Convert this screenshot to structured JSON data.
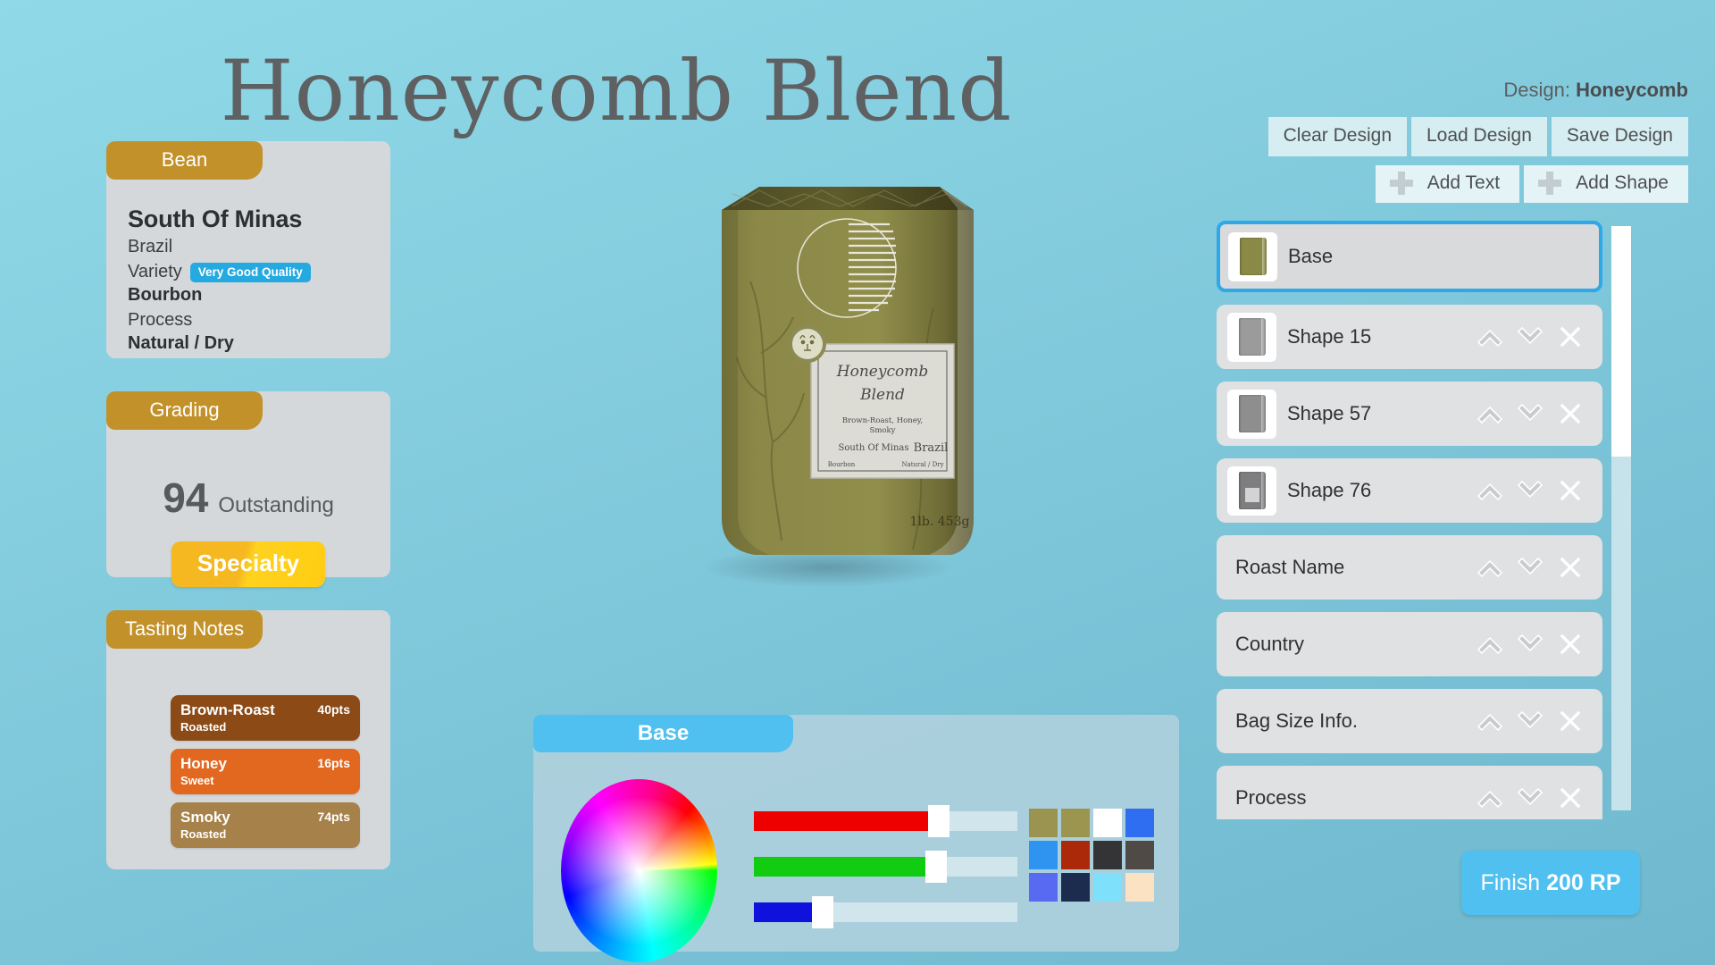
{
  "title": "Honeycomb Blend",
  "header": {
    "design_prefix": "Design:",
    "design_name": "Honeycomb"
  },
  "toolbar": {
    "clear_design": "Clear Design",
    "load_design": "Load Design",
    "save_design": "Save Design",
    "add_text": "Add Text",
    "add_shape": "Add Shape"
  },
  "bean": {
    "tab": "Bean",
    "origin": "South Of Minas",
    "country": "Brazil",
    "variety_label": "Variety",
    "quality_badge": "Very Good Quality",
    "variety_value": "Bourbon",
    "process_label": "Process",
    "process_value": "Natural / Dry"
  },
  "grading": {
    "tab": "Grading",
    "score": "94",
    "word": "Outstanding",
    "badge": "Specialty"
  },
  "tasting": {
    "tab": "Tasting Notes",
    "notes": [
      {
        "name": "Brown-Roast",
        "sub": "Roasted",
        "pts": "40pts",
        "color": "#8b4a16"
      },
      {
        "name": "Honey",
        "sub": "Sweet",
        "pts": "16pts",
        "color": "#e2671f"
      },
      {
        "name": "Smoky",
        "sub": "Roasted",
        "pts": "74pts",
        "color": "#a68149"
      }
    ]
  },
  "layers": [
    {
      "name": "Base",
      "selected": true,
      "thumb": "#8a8a46",
      "has_thumb": true,
      "has_actions": false,
      "inner": false
    },
    {
      "name": "Shape 15",
      "selected": false,
      "thumb": "#9b9b9b",
      "has_thumb": true,
      "has_actions": true,
      "inner": false
    },
    {
      "name": "Shape 57",
      "selected": false,
      "thumb": "#8e8e8e",
      "has_thumb": true,
      "has_actions": true,
      "inner": false
    },
    {
      "name": "Shape 76",
      "selected": false,
      "thumb": "#7e7e80",
      "has_thumb": true,
      "has_actions": true,
      "inner": true
    },
    {
      "name": "Roast Name",
      "selected": false,
      "thumb": "",
      "has_thumb": false,
      "has_actions": true,
      "inner": false
    },
    {
      "name": "Country",
      "selected": false,
      "thumb": "",
      "has_thumb": false,
      "has_actions": true,
      "inner": false
    },
    {
      "name": "Bag Size Info.",
      "selected": false,
      "thumb": "",
      "has_thumb": false,
      "has_actions": true,
      "inner": false
    },
    {
      "name": "Process",
      "selected": false,
      "thumb": "",
      "has_thumb": false,
      "has_actions": true,
      "inner": false
    }
  ],
  "picker": {
    "tab": "Base",
    "sliders": [
      {
        "channel": "R",
        "color": "#ee0000",
        "value": 70
      },
      {
        "channel": "G",
        "color": "#11cc11",
        "value": 69
      },
      {
        "channel": "B",
        "color": "#1111dd",
        "value": 26
      }
    ],
    "swatches": [
      "#9a9450",
      "#9b954f",
      "#ffffff",
      "#2f6ef0",
      "#2f93f0",
      "#ab2908",
      "#343436",
      "#4f4a46",
      "#5869f2",
      "#1b2c4e",
      "#7ee0fa",
      "#fbe2c2"
    ]
  },
  "bag": {
    "name_line1": "Honeycomb",
    "name_line2": "Blend",
    "notes_line1": "Brown-Roast, Honey,",
    "notes_line2": "Smoky",
    "origin": "South Of Minas",
    "country": "Brazil",
    "variety": "Bourbon",
    "process": "Natural / Dry",
    "size": "1lb. 453g"
  },
  "finish": {
    "label": "Finish",
    "cost": "200 RP"
  }
}
